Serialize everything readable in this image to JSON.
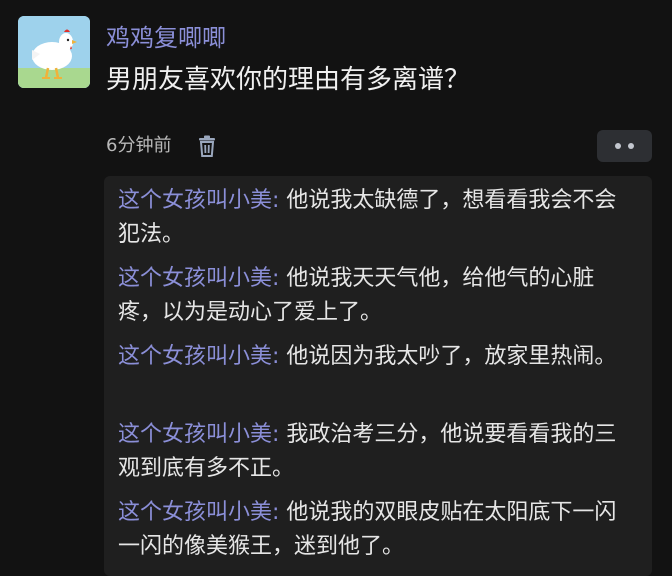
{
  "post": {
    "username": "鸡鸡复唧唧",
    "title": "男朋友喜欢你的理由有多离谱？",
    "time": "6分钟前"
  },
  "icons": {
    "avatar": "white-chicken-avatar",
    "delete": "trash-icon",
    "more": "more-dots-icon"
  },
  "colors": {
    "username": "#8b8fd8",
    "background": "#121212",
    "reply_box": "#1f1f1f"
  },
  "replies": [
    {
      "author": "这个女孩叫小美",
      "sep": ": ",
      "text": "他说我太缺德了，想看看我会不会犯法。"
    },
    {
      "author": "这个女孩叫小美",
      "sep": ": ",
      "text": "他说我天天气他，给他气的心脏疼，以为是动心了爱上了。"
    },
    {
      "author": "这个女孩叫小美",
      "sep": ": ",
      "text": "他说因为我太吵了，放家里热闹。"
    },
    {
      "author": "这个女孩叫小美",
      "sep": ": ",
      "text": "我政治考三分，他说要看看我的三观到底有多不正。"
    },
    {
      "author": "这个女孩叫小美",
      "sep": ": ",
      "text": "他说我的双眼皮贴在太阳底下一闪一闪的像美猴王，迷到他了。"
    }
  ]
}
